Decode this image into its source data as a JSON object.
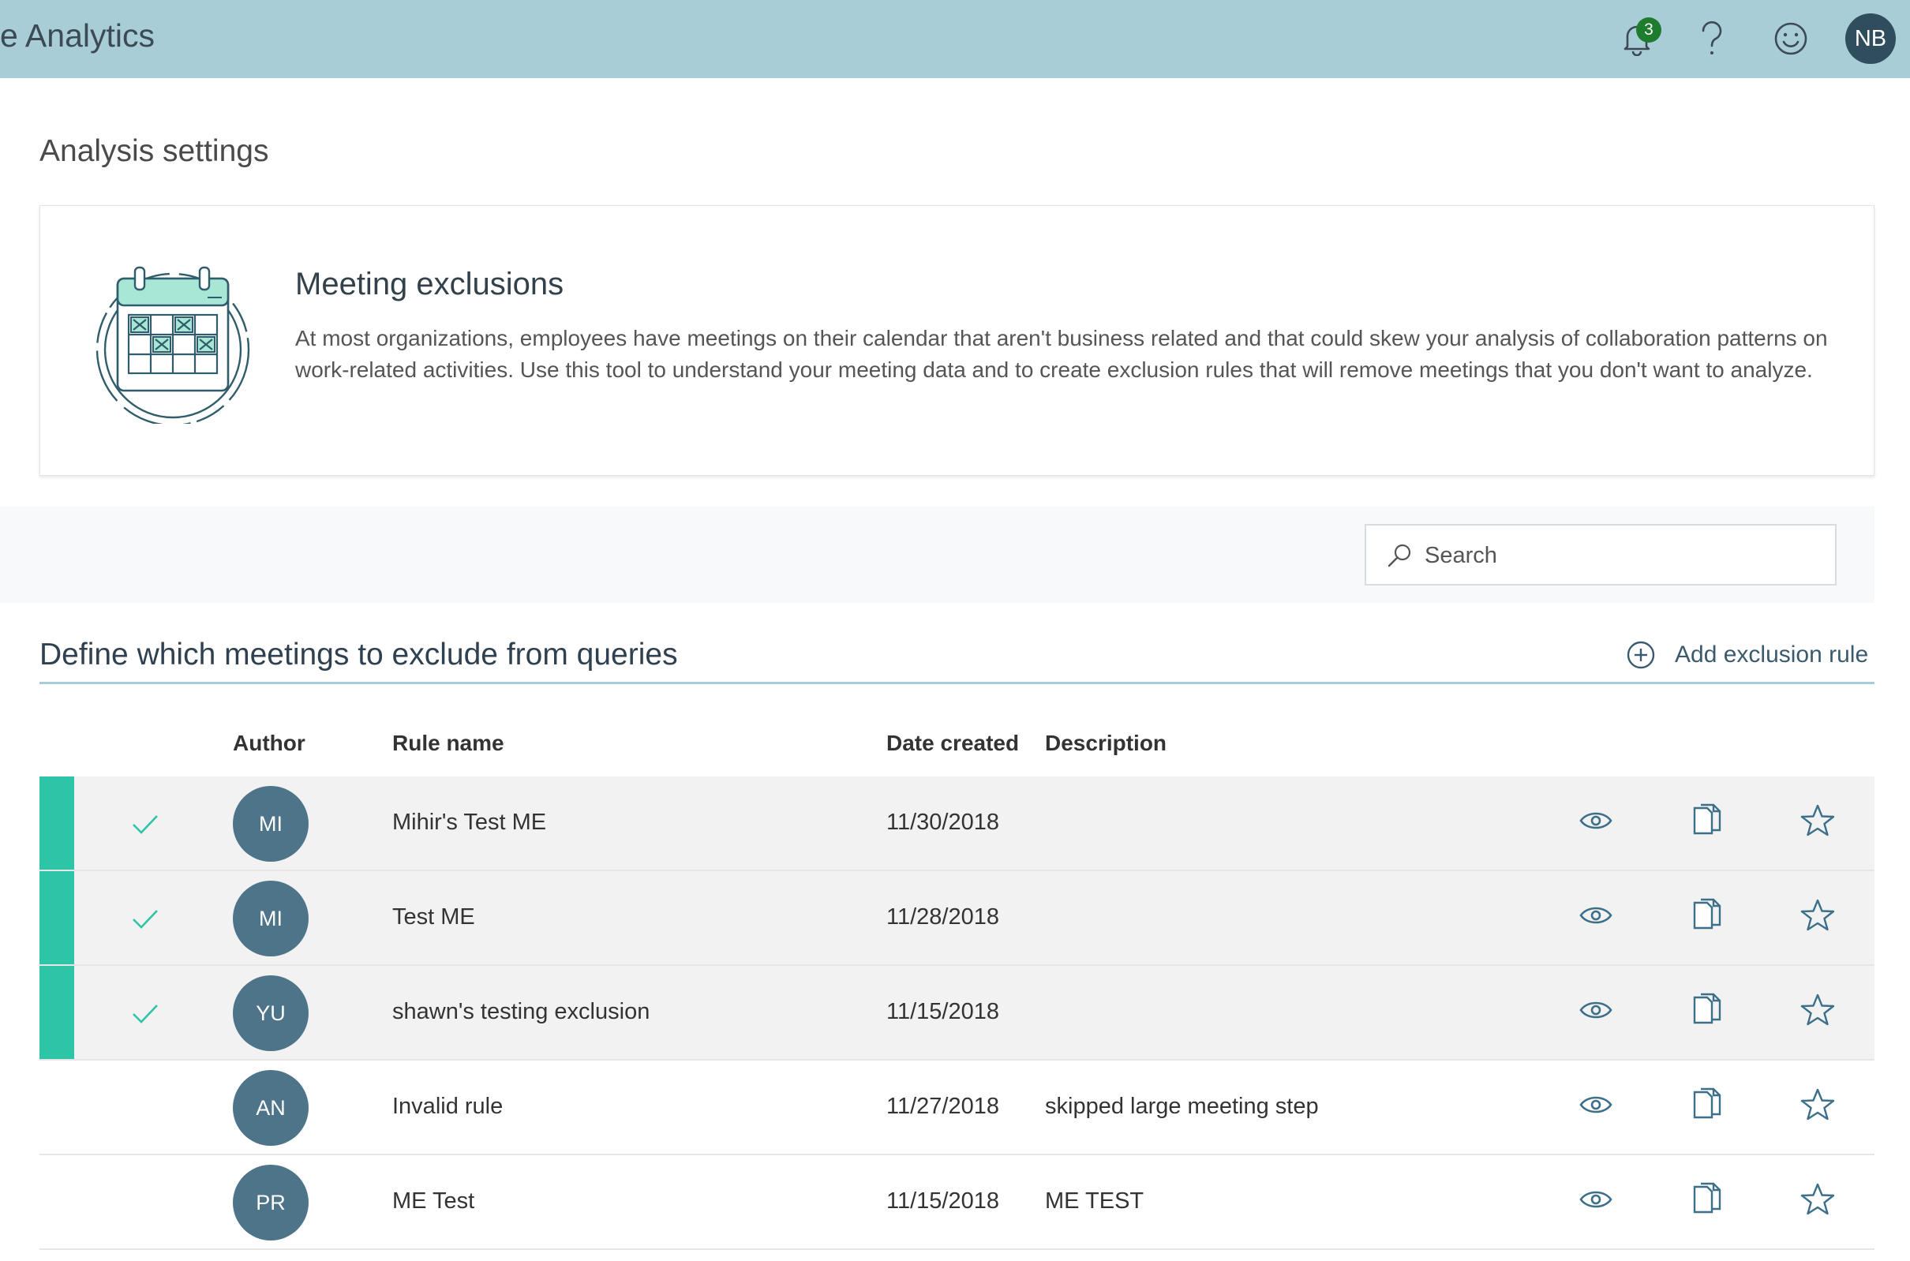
{
  "header": {
    "app_title": "e Analytics",
    "notification_count": "3",
    "user_initials": "NB"
  },
  "page": {
    "title": "Analysis settings"
  },
  "card": {
    "title": "Meeting exclusions",
    "text": "At most organizations, employees have meetings on their calendar that aren't business related and that could skew your analysis of collaboration patterns on work-related activities. Use this tool to understand your meeting data and to create exclusion rules that will remove meetings that you don't want to analyze.",
    "illustration_icon": "calendar-icon"
  },
  "search": {
    "placeholder": "Search",
    "value": ""
  },
  "section": {
    "title": "Define which meetings to exclude from queries",
    "add_label": "Add exclusion rule"
  },
  "table": {
    "columns": {
      "author": "Author",
      "rule_name": "Rule name",
      "date_created": "Date created",
      "description": "Description"
    },
    "rows": [
      {
        "selected": true,
        "author": "MI",
        "name": "Mihir's Test ME",
        "date": "11/30/2018",
        "description": ""
      },
      {
        "selected": true,
        "author": "MI",
        "name": "Test ME",
        "date": "11/28/2018",
        "description": ""
      },
      {
        "selected": true,
        "author": "YU",
        "name": "shawn's testing exclusion",
        "date": "11/15/2018",
        "description": ""
      },
      {
        "selected": false,
        "author": "AN",
        "name": "Invalid rule",
        "date": "11/27/2018",
        "description": "skipped large meeting step"
      },
      {
        "selected": false,
        "author": "PR",
        "name": "ME Test",
        "date": "11/15/2018",
        "description": "ME TEST"
      }
    ]
  },
  "colors": {
    "header_bg": "#a9cdd6",
    "accent": "#2ec4a8",
    "avatar": "#4e7489",
    "badge": "#1e7c2e"
  }
}
